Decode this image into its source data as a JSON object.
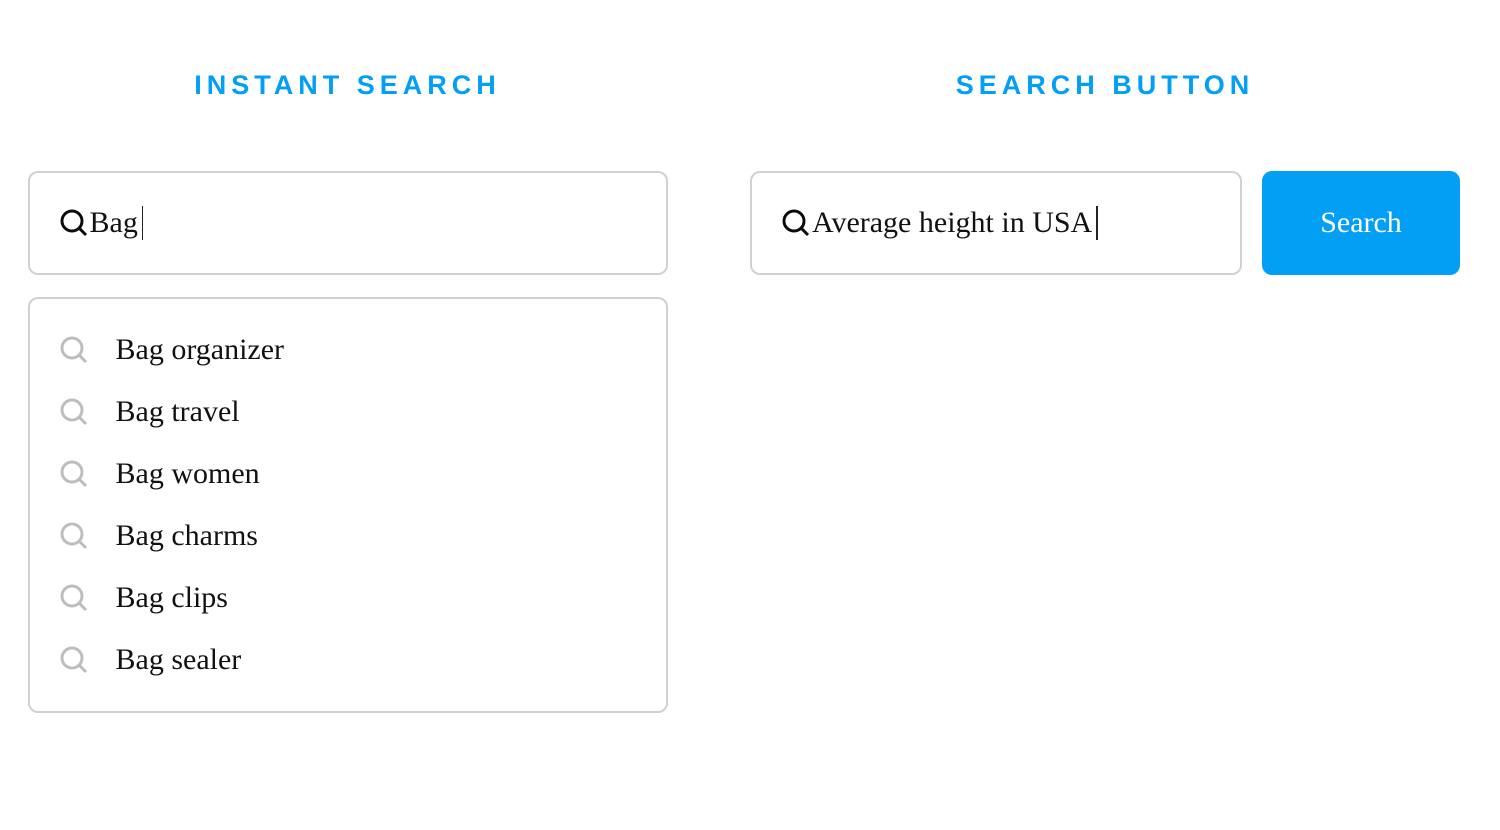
{
  "left": {
    "heading": "INSTANT SEARCH",
    "query": "Bag",
    "suggestions": [
      "Bag organizer",
      "Bag travel",
      "Bag women",
      "Bag charms",
      "Bag clips",
      "Bag sealer"
    ]
  },
  "right": {
    "heading": "SEARCH BUTTON",
    "query": "Average height in USA",
    "button_label": "Search"
  },
  "colors": {
    "accent": "#029ff5",
    "border": "#d1d1d1",
    "icon_grey": "#bdbdbd"
  }
}
